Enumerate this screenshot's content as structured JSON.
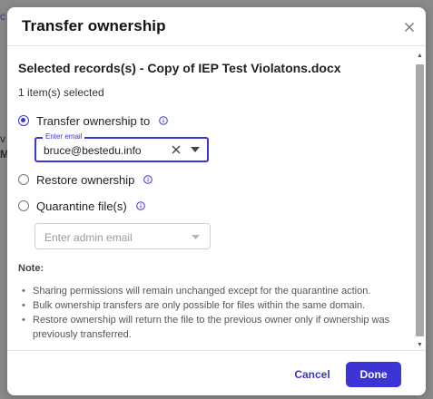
{
  "background": {
    "fragments": [
      "c",
      "v",
      "M"
    ]
  },
  "dialog": {
    "title": "Transfer ownership",
    "records_title": "Selected records(s) - Copy of IEP Test Violatons.docx",
    "records_count": "1 item(s) selected",
    "options": [
      {
        "label": "Transfer ownership to",
        "selected": true
      },
      {
        "label": "Restore ownership",
        "selected": false
      },
      {
        "label": "Quarantine file(s)",
        "selected": false
      }
    ],
    "email_field": {
      "legend": "Enter email",
      "value": "bruce@bestedu.info"
    },
    "admin_field": {
      "placeholder": "Enter admin email"
    },
    "note": {
      "heading": "Note:",
      "items": [
        "Sharing permissions will remain unchanged except for the quarantine action.",
        "Bulk ownership transfers are only possible for files within the same domain.",
        "Restore ownership will return the file to the previous owner only if ownership was previously transferred."
      ]
    },
    "footer": {
      "cancel_label": "Cancel",
      "done_label": "Done"
    }
  },
  "colors": {
    "accent": "#3b35d6",
    "overlay": "#8a8a8a"
  },
  "icons": {
    "close": "close-icon",
    "info": "info-icon",
    "clear": "clear-icon",
    "dropdown": "chevron-down-icon"
  }
}
